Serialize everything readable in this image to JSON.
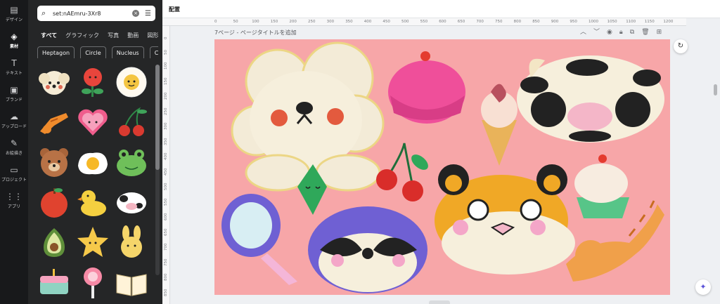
{
  "rail": {
    "items": [
      {
        "label": "デザイン",
        "icon": "▤"
      },
      {
        "label": "素材",
        "icon": "◈"
      },
      {
        "label": "テキスト",
        "icon": "T"
      },
      {
        "label": "ブランド",
        "icon": "▣"
      },
      {
        "label": "アップロード",
        "icon": "☁"
      },
      {
        "label": "お絵描き",
        "icon": "✎"
      },
      {
        "label": "プロジェクト",
        "icon": "▭"
      },
      {
        "label": "アプリ",
        "icon": "⋮⋮"
      }
    ]
  },
  "search": {
    "value": "set:nAEmru-3Xr8",
    "search_icon": "search-icon",
    "clear_icon": "close-icon",
    "filter_icon": "filter-icon"
  },
  "tabs": [
    "すべて",
    "グラフィック",
    "写真",
    "動画",
    "図形",
    "オ"
  ],
  "chips": [
    "Heptagon",
    "Circle",
    "Nucleus",
    "C"
  ],
  "topbar": {
    "title": "配置"
  },
  "ruler_top": [
    "0",
    "50",
    "100",
    "150",
    "200",
    "250",
    "300",
    "350",
    "400",
    "450",
    "500",
    "550",
    "600",
    "650",
    "700",
    "750",
    "800",
    "850",
    "900",
    "950",
    "1000",
    "1050",
    "1100",
    "1150",
    "1200"
  ],
  "ruler_left": [
    "0",
    "50",
    "100",
    "150",
    "200",
    "250",
    "300",
    "350",
    "400",
    "450",
    "500",
    "550",
    "600",
    "650",
    "700",
    "750",
    "800",
    "850"
  ],
  "page": {
    "title": "7ページ - ページタイトルを追加"
  },
  "stickers": [
    "poodle",
    "tulip",
    "daisy",
    "cat",
    "heart",
    "cherries",
    "bear",
    "egg",
    "frog",
    "apple",
    "duck",
    "cow",
    "avocado",
    "star",
    "bunny",
    "cake",
    "lollipop",
    "book"
  ],
  "colors": {
    "canvas_bg": "#f7a6a8",
    "accent": "#8b7cf6"
  }
}
